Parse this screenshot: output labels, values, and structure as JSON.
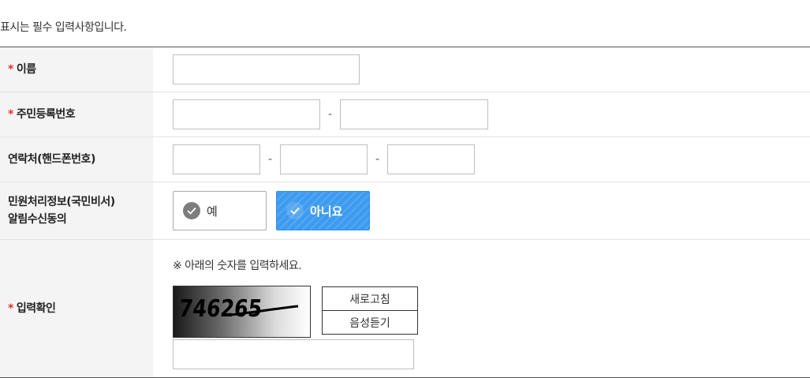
{
  "notice": "표시는 필수 입력사항입니다.",
  "required_mark": "*",
  "fields": {
    "name": {
      "label": "이름",
      "required": true,
      "value": ""
    },
    "rrn": {
      "label": "주민등록번호",
      "required": true,
      "separator": "-",
      "value1": "",
      "value2": ""
    },
    "phone": {
      "label": "연락처(핸드폰번호)",
      "required": false,
      "separator": "-",
      "value1": "",
      "value2": "",
      "value3": ""
    },
    "consent": {
      "label_line1": "민원처리정보(국민비서)",
      "label_line2": "알림수신동의",
      "yes_label": "예",
      "no_label": "아니요",
      "selected": "no"
    },
    "captcha": {
      "label": "입력확인",
      "required": true,
      "instruction": "※ 아래의 숫자를 입력하세요.",
      "image_text": "746265",
      "refresh_label": "새로고침",
      "audio_label": "음성듣기",
      "value": ""
    }
  },
  "colors": {
    "required": "#e5302f",
    "selected": "#3d9bef",
    "header_bg": "#f4f4f4"
  },
  "icons": {
    "check": "check-circle-icon"
  }
}
